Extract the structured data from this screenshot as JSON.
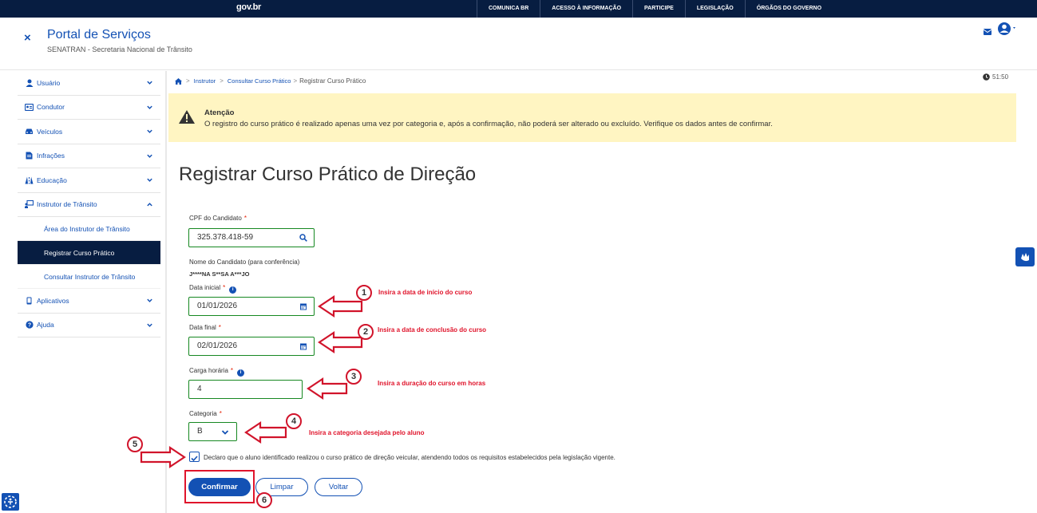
{
  "topbar": {
    "brand": "gov.br",
    "links": [
      "COMUNICA BR",
      "ACESSO À INFORMAÇÃO",
      "PARTICIPE",
      "LEGISLAÇÃO",
      "ÓRGÃOS DO GOVERNO"
    ]
  },
  "header": {
    "close_label": "×",
    "title": "Portal de Serviços",
    "subtitle": "SENATRAN - Secretaria Nacional de Trânsito"
  },
  "sidebar": {
    "items": [
      {
        "label": "Usuário",
        "icon": "user-icon"
      },
      {
        "label": "Condutor",
        "icon": "id-card-icon"
      },
      {
        "label": "Veículos",
        "icon": "car-icon"
      },
      {
        "label": "Infrações",
        "icon": "document-icon"
      },
      {
        "label": "Educação",
        "icon": "road-icon"
      },
      {
        "label": "Instrutor de Trânsito",
        "icon": "instructor-icon"
      },
      {
        "label": "Aplicativos",
        "icon": "mobile-icon"
      },
      {
        "label": "Ajuda",
        "icon": "help-icon"
      }
    ],
    "subitems": [
      "Área do Instrutor de Trânsito",
      "Registrar Curso Prático",
      "Consultar Instrutor de Trânsito"
    ]
  },
  "breadcrumb": {
    "items": [
      "Instrutor",
      "Consultar Curso Prático"
    ],
    "current": "Registrar Curso Prático"
  },
  "session_timer": "51:50",
  "alert": {
    "title": "Atenção",
    "message": "O registro do curso prático é realizado apenas uma vez por categoria e, após a confirmação, não poderá ser alterado ou excluído. Verifique os dados antes de confirmar."
  },
  "form": {
    "page_title": "Registrar Curso Prático de Direção",
    "cpf_label": "CPF do Candidato",
    "cpf_value": "325.378.418-59",
    "nome_label": "Nome do Candidato (para conferência)",
    "nome_value": "J****NA S**SA A***JO",
    "data_inicial_label": "Data inicial",
    "data_inicial_value": "01/01/2026",
    "data_final_label": "Data final",
    "data_final_value": "02/01/2026",
    "carga_label": "Carga horária",
    "carga_value": "4",
    "categoria_label": "Categoria",
    "categoria_value": "B",
    "required_mark": "*",
    "declaration": "Declaro que o aluno identificado realizou o curso prático de direção veicular, atendendo todos os requisitos estabelecidos pela legislação vigente.",
    "confirm_label": "Confirmar",
    "clear_label": "Limpar",
    "back_label": "Voltar"
  },
  "annotations": {
    "n1": "1",
    "t1": "Insira a data de início do curso",
    "n2": "2",
    "t2": "Insira a data de conclusão do curso",
    "n3": "3",
    "t3": "Insira a duração do curso em horas",
    "n4": "4",
    "t4": "Insira a categoria desejada pelo aluno",
    "n5": "5",
    "n6": "6"
  },
  "colors": {
    "primary": "#1351b4",
    "dark_navy": "#071d41",
    "alert_bg": "#fff5c2",
    "success_border": "#168821",
    "annotation_red": "#e0142b"
  }
}
